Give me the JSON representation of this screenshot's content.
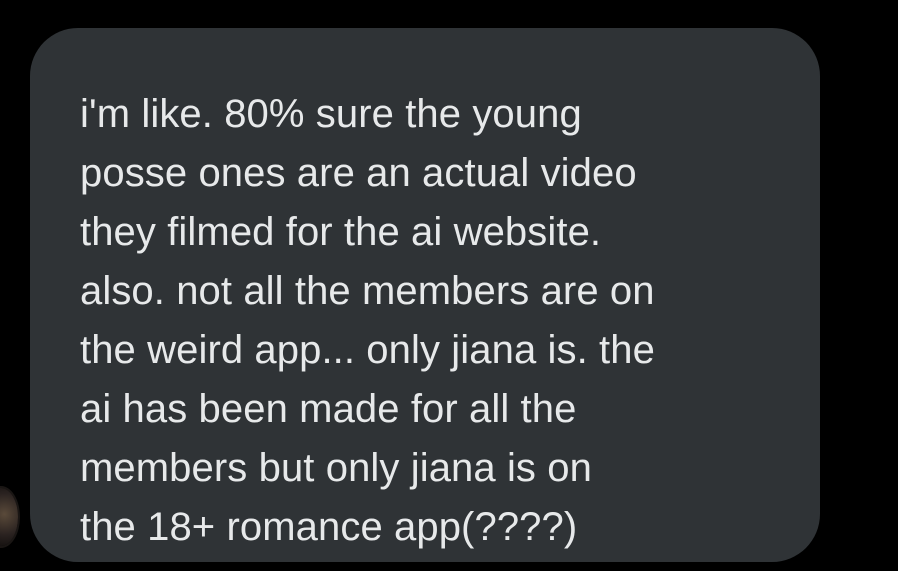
{
  "message": {
    "lines": [
      "i'm like. 80% sure the young",
      "posse ones are an actual video",
      "they filmed for the ai website.",
      "also. not all the members are on",
      "the weird app... only jiana is. the",
      "ai has been made for all the",
      "members but only jiana is on",
      "the 18+ romance app(????)"
    ]
  },
  "colors": {
    "background": "#000000",
    "bubble": "#2f3336",
    "text": "#e7e9ea"
  }
}
